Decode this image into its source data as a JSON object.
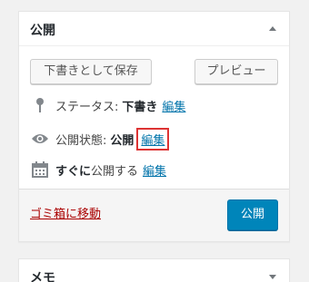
{
  "publish_box": {
    "title": "公開",
    "save_draft_label": "下書きとして保存",
    "preview_label": "プレビュー",
    "status": {
      "label": "ステータス:",
      "value": "下書き",
      "edit_label": "編集"
    },
    "visibility": {
      "label": "公開状態:",
      "value": "公開",
      "edit_label": "編集"
    },
    "schedule": {
      "value": "すぐに",
      "label": "公開する",
      "edit_label": "編集"
    },
    "trash_label": "ゴミ箱に移動",
    "publish_label": "公開"
  },
  "memo_box": {
    "title": "メモ"
  },
  "icons": {
    "status": "pin-icon",
    "visibility": "eye-icon",
    "schedule": "calendar-icon"
  },
  "colors": {
    "link": "#0073aa",
    "trash": "#a00",
    "primary": "#0085ba",
    "highlight_outline": "#dd3333"
  }
}
